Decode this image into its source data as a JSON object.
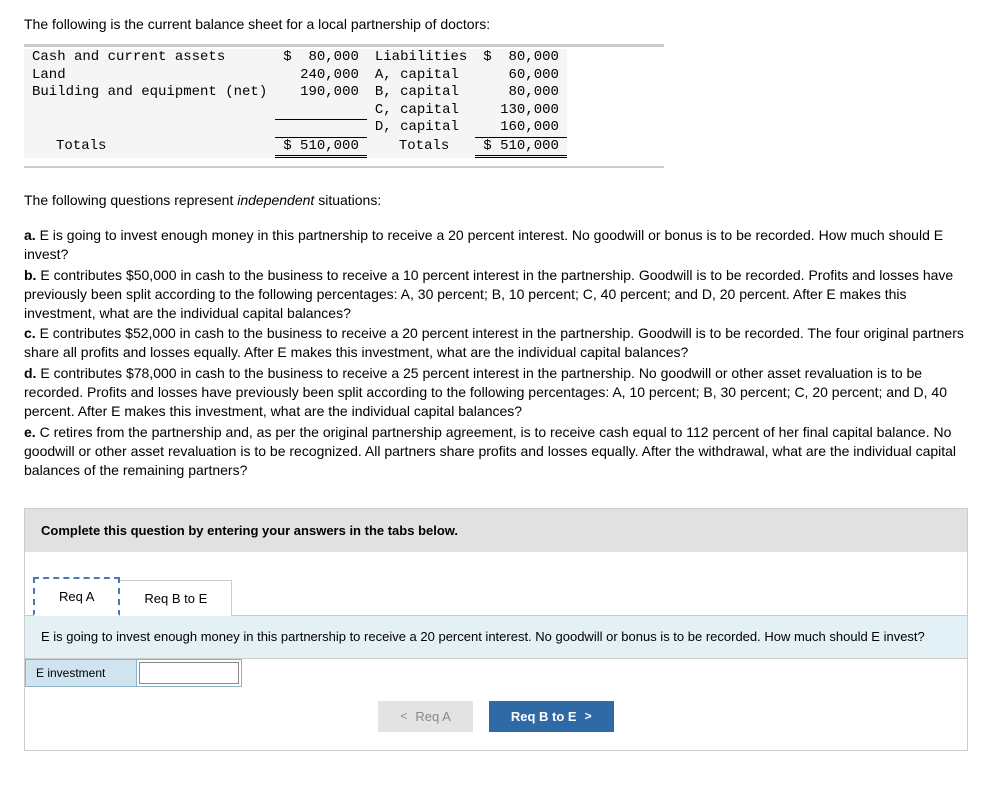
{
  "intro": "The following is the current balance sheet for a local partnership of doctors:",
  "balance_sheet": {
    "left": [
      {
        "label": "Cash and current assets",
        "value": "$  80,000"
      },
      {
        "label": "Land",
        "value": "240,000"
      },
      {
        "label": "Building and equipment (net)",
        "value": "190,000"
      }
    ],
    "right": [
      {
        "label": "Liabilities",
        "value": "$  80,000"
      },
      {
        "label": "A, capital",
        "value": "60,000"
      },
      {
        "label": "B, capital",
        "value": "80,000"
      },
      {
        "label": "C, capital",
        "value": "130,000"
      },
      {
        "label": "D, capital",
        "value": "160,000"
      }
    ],
    "totals": {
      "label": "Totals",
      "left": "$ 510,000",
      "right": "$ 510,000"
    }
  },
  "questions_intro_a": "The following questions represent ",
  "questions_intro_b": "independent",
  "questions_intro_c": " situations:",
  "q": {
    "a": "E is going to invest enough money in this partnership to receive a 20 percent interest. No goodwill or bonus is to be recorded. How much should E invest?",
    "b": "E contributes $50,000 in cash to the business to receive a 10 percent interest in the partnership. Goodwill is to be recorded. Profits and losses have previously been split according to the following percentages: A, 30 percent; B, 10 percent; C, 40 percent; and D, 20 percent. After E makes this investment, what are the individual capital balances?",
    "c": "E contributes $52,000 in cash to the business to receive a 20 percent interest in the partnership. Goodwill is to be recorded. The four original partners share all profits and losses equally. After E makes this investment, what are the individual capital balances?",
    "d": "E contributes $78,000 in cash to the business to receive a 25 percent interest in the partnership. No goodwill or other asset revaluation is to be recorded. Profits and losses have previously been split according to the following percentages: A, 10 percent; B, 30 percent; C, 20 percent; and D, 40 percent. After E makes this investment, what are the individual capital balances?",
    "e": "C retires from the partnership and, as per the original partnership agreement, is to receive cash equal to 112 percent of her final capital balance. No goodwill or other asset revaluation is to be recognized. All partners share profits and losses equally. After the withdrawal, what are the individual capital balances of the remaining partners?"
  },
  "labels": {
    "a": "a.",
    "b": "b.",
    "c": "c.",
    "d": "d.",
    "e": "e."
  },
  "complete_prompt": "Complete this question by entering your answers in the tabs below.",
  "tabs": {
    "a": "Req A",
    "b": "Req B to E"
  },
  "tab_content": "E is going to invest enough money in this partnership to receive a 20 percent interest. No goodwill or bonus is to be recorded. How much should E invest?",
  "input_label": "E investment",
  "nav": {
    "prev": "Req A",
    "next": "Req B to E"
  }
}
